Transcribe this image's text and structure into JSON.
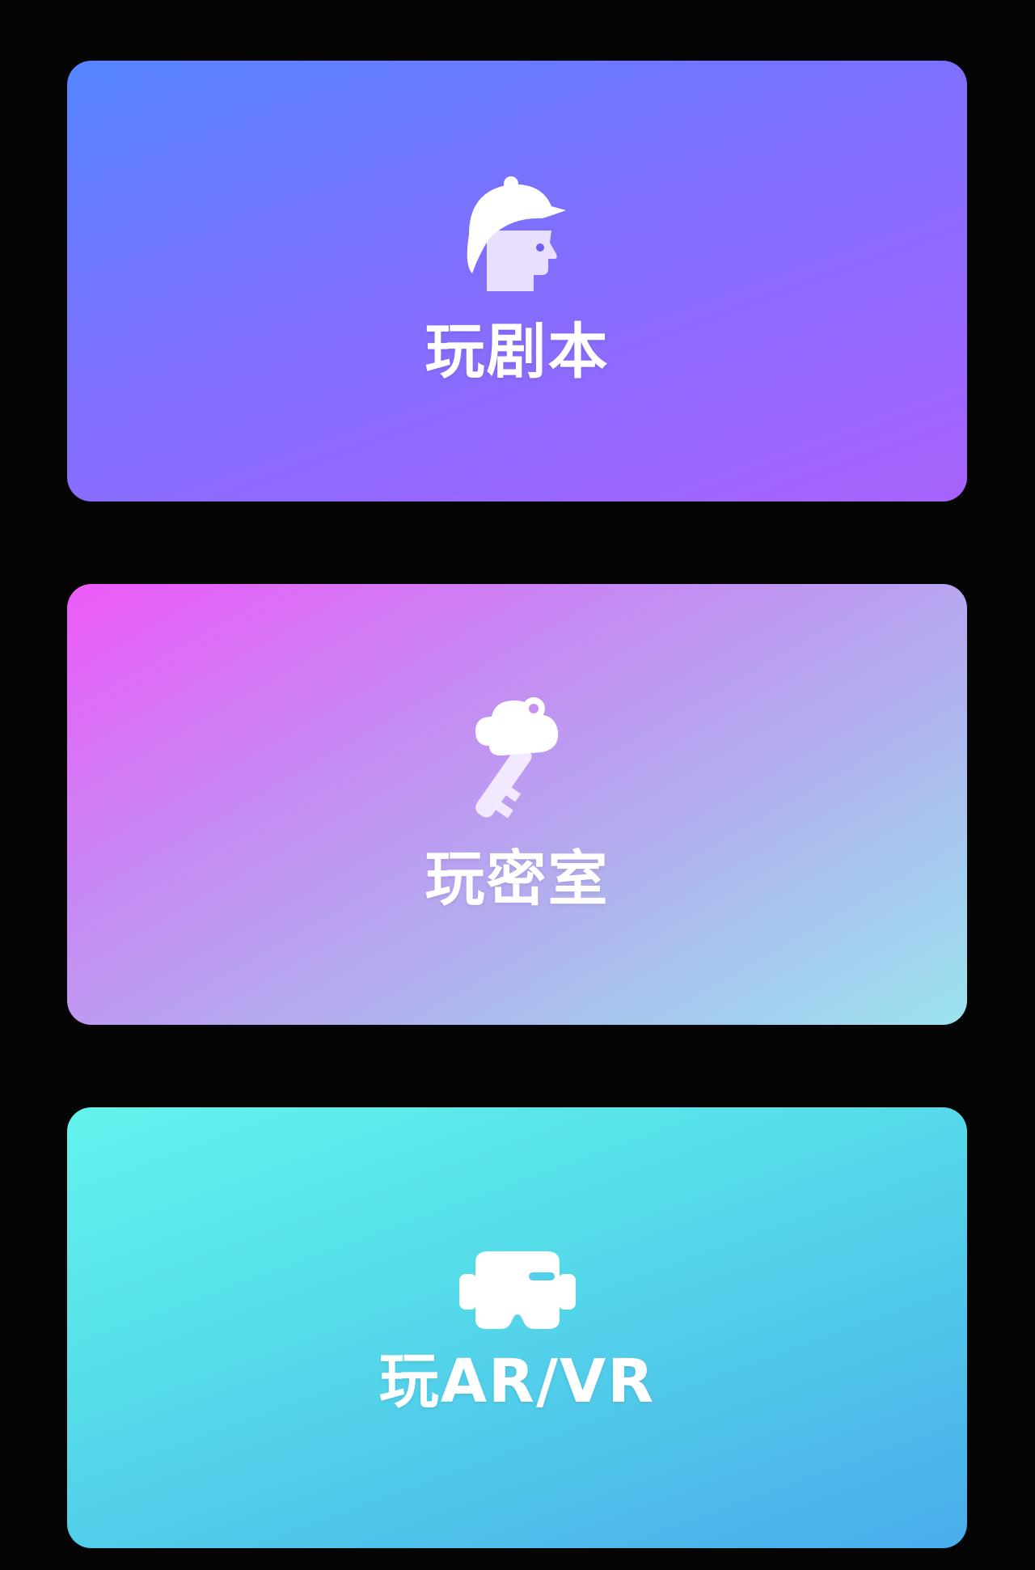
{
  "cards": [
    {
      "label": "玩剧本",
      "icon": "helmet-head-icon",
      "gradient": [
        "#5485fe",
        "#7f6ffd",
        "#a862fc"
      ]
    },
    {
      "label": "玩密室",
      "icon": "key-icon",
      "gradient": [
        "#ed5af9",
        "#c58bf3",
        "#b0b3ee",
        "#9ae3ee"
      ]
    },
    {
      "label": "玩AR/VR",
      "icon": "vr-headset-icon",
      "gradient": [
        "#63f4ec",
        "#55dce9",
        "#4aacec"
      ]
    }
  ],
  "colors": {
    "background": "#050505",
    "text": "#ffffff"
  }
}
